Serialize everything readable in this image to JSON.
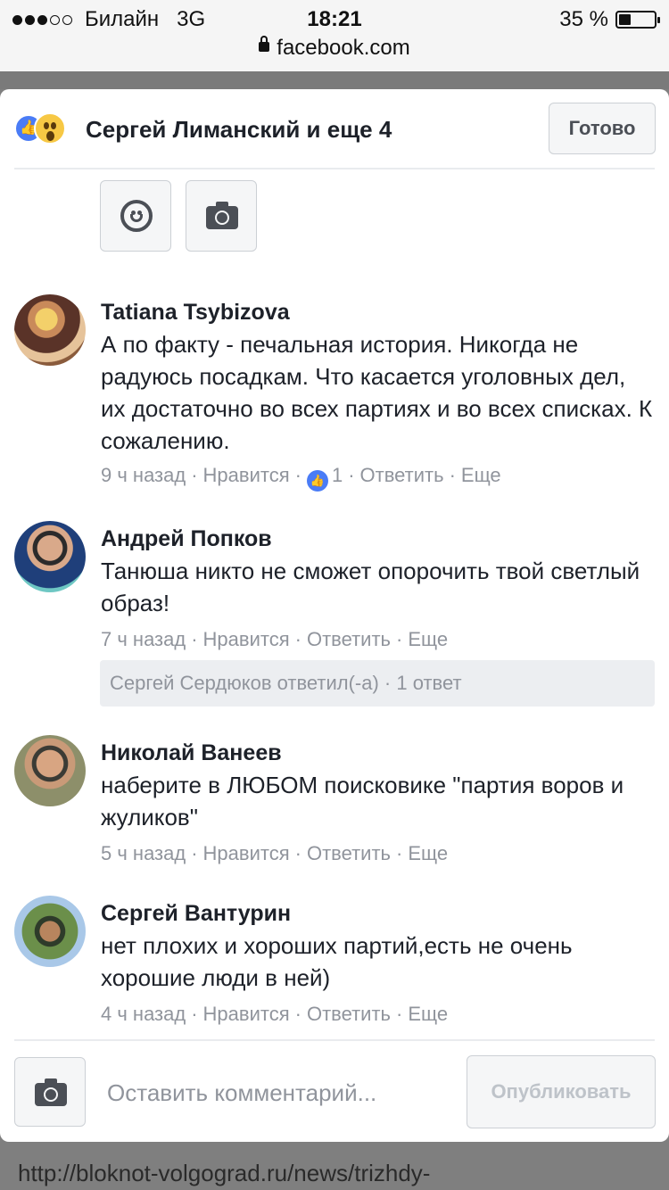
{
  "status_bar": {
    "carrier": "Билайн",
    "network": "3G",
    "time": "18:21",
    "battery": "35 %",
    "battery_level": 0.35,
    "url": "facebook.com"
  },
  "header": {
    "title": "Сергей Лиманский и еще 4",
    "done_label": "Готово"
  },
  "comments": [
    {
      "name": "Tatiana Tsybizova",
      "text": "А по факту - печальная история. Никогда не радуюсь посадкам. Что касается уголовных дел, их достаточно во всех партиях и во всех списках. К сожалению.",
      "time": "9 ч назад",
      "like": "Нравится",
      "likes_count": "1",
      "reply": "Ответить",
      "more": "Еще"
    },
    {
      "name": "Андрей Попков",
      "text": "Танюша никто не сможет опорочить твой светлый образ!",
      "time": "7 ч назад",
      "like": "Нравится",
      "reply": "Ответить",
      "more": "Еще",
      "replies_summary": "Сергей Сердюков ответил(-а) · 1 ответ"
    },
    {
      "name": "Николай Ванеев",
      "text": "наберите в ЛЮБОМ поисковике \"партия воров и жуликов\"",
      "time": "5 ч назад",
      "like": "Нравится",
      "reply": "Ответить",
      "more": "Еще"
    },
    {
      "name": "Сергей Вантурин",
      "text": "нет плохих и хороших партий,есть не очень хорошие люди в ней)",
      "time": "4 ч назад",
      "like": "Нравится",
      "reply": "Ответить",
      "more": "Еще"
    }
  ],
  "composer": {
    "placeholder": "Оставить комментарий...",
    "publish_label": "Опубликовать"
  },
  "background_link": "http://bloknot-volgograd.ru/news/trizhdy-",
  "colors": {
    "accent": "#4a7cf6",
    "meta_text": "#90949c",
    "wow": "#f7c844"
  }
}
